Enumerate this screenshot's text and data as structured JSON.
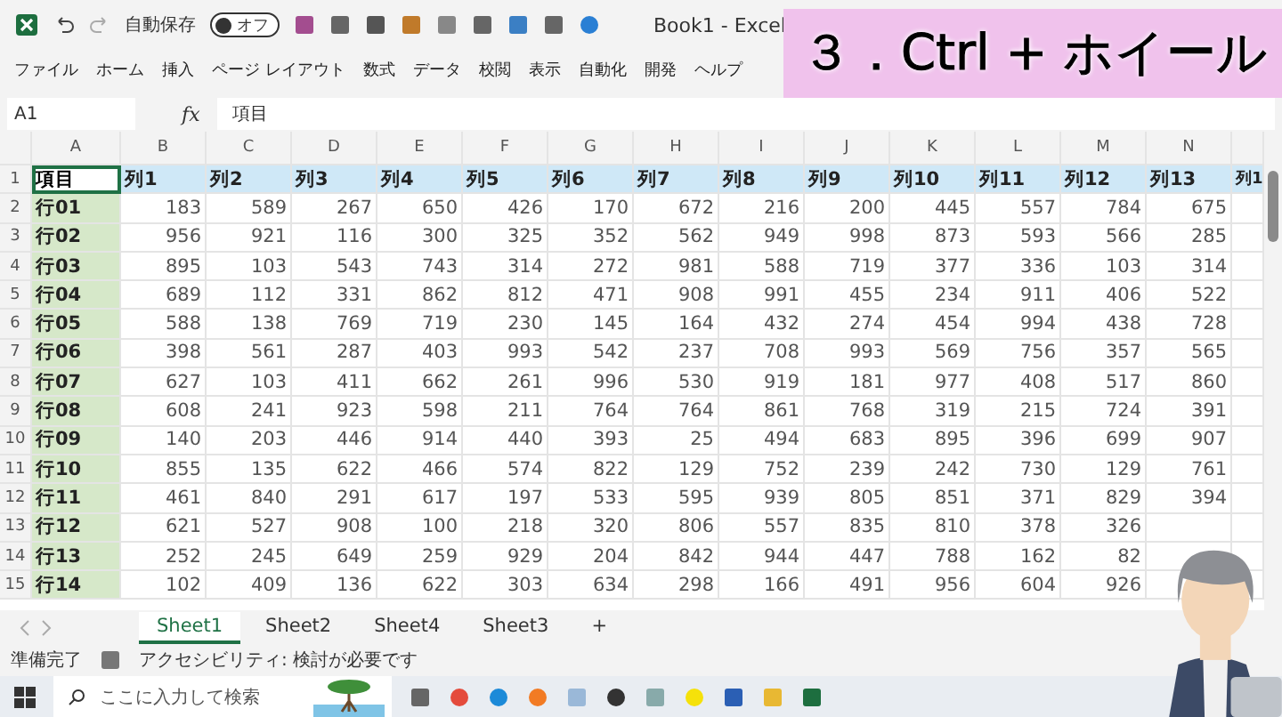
{
  "title_bar": {
    "autosave": {
      "label": "自動保存",
      "toggle_label": "オフ",
      "on": false
    },
    "title": "Book1  -  Excel"
  },
  "menu": [
    "ファイル",
    "ホーム",
    "挿入",
    "ページ レイアウト",
    "数式",
    "データ",
    "校閲",
    "表示",
    "自動化",
    "開発",
    "ヘルプ"
  ],
  "caption": "３．Ctrl + ホイール",
  "formula_bar": {
    "name_box": "A1",
    "fx": "fx",
    "value": "項目"
  },
  "sheet": {
    "columns": [
      "A",
      "B",
      "C",
      "D",
      "E",
      "F",
      "G",
      "H",
      "I",
      "J",
      "K",
      "L",
      "M",
      "N"
    ],
    "header_row": {
      "number": "1",
      "cells": [
        "項目",
        "列1",
        "列2",
        "列3",
        "列4",
        "列5",
        "列6",
        "列7",
        "列8",
        "列9",
        "列10",
        "列11",
        "列12",
        "列13",
        "列1"
      ]
    },
    "rows": [
      {
        "number": "2",
        "label": "行01",
        "values": [
          "183",
          "589",
          "267",
          "650",
          "426",
          "170",
          "672",
          "216",
          "200",
          "445",
          "557",
          "784",
          "675"
        ]
      },
      {
        "number": "3",
        "label": "行02",
        "values": [
          "956",
          "921",
          "116",
          "300",
          "325",
          "352",
          "562",
          "949",
          "998",
          "873",
          "593",
          "566",
          "285"
        ]
      },
      {
        "number": "4",
        "label": "行03",
        "values": [
          "895",
          "103",
          "543",
          "743",
          "314",
          "272",
          "981",
          "588",
          "719",
          "377",
          "336",
          "103",
          "314"
        ]
      },
      {
        "number": "5",
        "label": "行04",
        "values": [
          "689",
          "112",
          "331",
          "862",
          "812",
          "471",
          "908",
          "991",
          "455",
          "234",
          "911",
          "406",
          "522"
        ]
      },
      {
        "number": "6",
        "label": "行05",
        "values": [
          "588",
          "138",
          "769",
          "719",
          "230",
          "145",
          "164",
          "432",
          "274",
          "454",
          "994",
          "438",
          "728"
        ]
      },
      {
        "number": "7",
        "label": "行06",
        "values": [
          "398",
          "561",
          "287",
          "403",
          "993",
          "542",
          "237",
          "708",
          "993",
          "569",
          "756",
          "357",
          "565"
        ]
      },
      {
        "number": "8",
        "label": "行07",
        "values": [
          "627",
          "103",
          "411",
          "662",
          "261",
          "996",
          "530",
          "919",
          "181",
          "977",
          "408",
          "517",
          "860"
        ]
      },
      {
        "number": "9",
        "label": "行08",
        "values": [
          "608",
          "241",
          "923",
          "598",
          "211",
          "764",
          "764",
          "861",
          "768",
          "319",
          "215",
          "724",
          "391"
        ]
      },
      {
        "number": "10",
        "label": "行09",
        "values": [
          "140",
          "203",
          "446",
          "914",
          "440",
          "393",
          "25",
          "494",
          "683",
          "895",
          "396",
          "699",
          "907"
        ]
      },
      {
        "number": "11",
        "label": "行10",
        "values": [
          "855",
          "135",
          "622",
          "466",
          "574",
          "822",
          "129",
          "752",
          "239",
          "242",
          "730",
          "129",
          "761"
        ]
      },
      {
        "number": "12",
        "label": "行11",
        "values": [
          "461",
          "840",
          "291",
          "617",
          "197",
          "533",
          "595",
          "939",
          "805",
          "851",
          "371",
          "829",
          "394"
        ]
      },
      {
        "number": "13",
        "label": "行12",
        "values": [
          "621",
          "527",
          "908",
          "100",
          "218",
          "320",
          "806",
          "557",
          "835",
          "810",
          "378",
          "326"
        ]
      },
      {
        "number": "14",
        "label": "行13",
        "values": [
          "252",
          "245",
          "649",
          "259",
          "929",
          "204",
          "842",
          "944",
          "447",
          "788",
          "162",
          "82"
        ]
      },
      {
        "number": "15",
        "label": "行14",
        "values": [
          "102",
          "409",
          "136",
          "622",
          "303",
          "634",
          "298",
          "166",
          "491",
          "956",
          "604",
          "926"
        ]
      }
    ]
  },
  "sheet_tabs": [
    {
      "label": "Sheet1",
      "selected": true
    },
    {
      "label": "Sheet2",
      "selected": false
    },
    {
      "label": "Sheet4",
      "selected": false
    },
    {
      "label": "Sheet3",
      "selected": false
    }
  ],
  "add_sheet": "+",
  "status_bar": {
    "ready": "準備完了",
    "accessibility": "アクセシビリティ: 検討が必要です"
  },
  "taskbar": {
    "search_placeholder": "ここに入力して検索"
  }
}
